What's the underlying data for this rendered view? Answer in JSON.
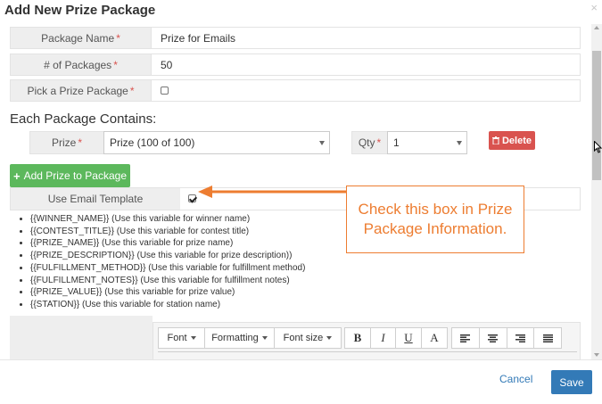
{
  "modal": {
    "title": "Add New Prize Package",
    "close": "×"
  },
  "fields": {
    "package_name": {
      "label": "Package Name",
      "required": "*",
      "value": "Prize for Emails"
    },
    "num_packages": {
      "label": "# of Packages",
      "required": "*",
      "value": "50"
    },
    "pick_prize": {
      "label": "Pick a Prize Package",
      "required": "*",
      "checked": false
    }
  },
  "contains": {
    "heading": "Each Package Contains:",
    "prize_label": "Prize",
    "prize_value": "Prize (100 of 100)",
    "qty_label": "Qty",
    "qty_value": "1",
    "delete_label": "Delete",
    "add_label": "Add Prize to Package"
  },
  "email_template": {
    "label": "Use Email Template",
    "checked": true
  },
  "variables": [
    "{{WINNER_NAME}} (Use this variable for winner name)",
    "{{CONTEST_TITLE}} (Use this variable for contest title)",
    "{{PRIZE_NAME}} (Use this variable for prize name)",
    "{{PRIZE_DESCRIPTION}} (Use this variable for prize description))",
    "{{FULFILLMENT_METHOD}} (Use this variable for fulfillment method)",
    "{{FULFILLMENT_NOTES}} (Use this variable for fulfillment notes)",
    "{{PRIZE_VALUE}} (Use this variable for prize value)",
    "{{STATION}} (Use this variable for station name)"
  ],
  "editor": {
    "font": "Font",
    "formatting": "Formatting",
    "font_size": "Font size",
    "bold": "B",
    "italic": "I",
    "underline": "U",
    "font_color": "A"
  },
  "callout": {
    "text": "Check this box in Prize Package Information."
  },
  "footer": {
    "cancel": "Cancel",
    "save": "Save"
  },
  "colors": {
    "accent_orange": "#ed7d31",
    "primary": "#337ab7",
    "success": "#5cb85c",
    "danger": "#d9534f"
  }
}
